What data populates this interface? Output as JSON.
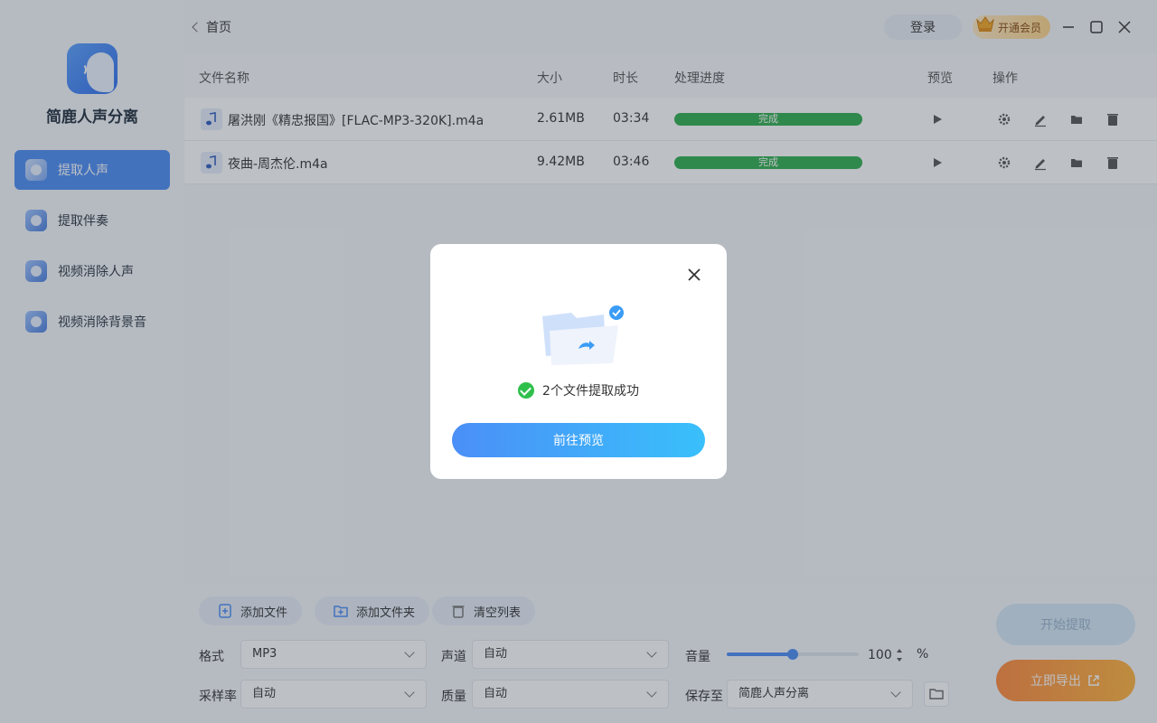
{
  "app": {
    "name": "简鹿人声分离"
  },
  "sidebar": {
    "items": [
      {
        "label": "提取人声",
        "icon": "vocal-extract-icon",
        "active": true
      },
      {
        "label": "提取伴奏",
        "icon": "accompaniment-icon",
        "active": false
      },
      {
        "label": "视频消除人声",
        "icon": "video-vocal-remove-icon",
        "active": false
      },
      {
        "label": "视频消除背景音",
        "icon": "video-bg-remove-icon",
        "active": false
      }
    ]
  },
  "header": {
    "breadcrumb": "首页",
    "login_label": "登录",
    "vip_label": "开通会员"
  },
  "table": {
    "columns": [
      "文件名称",
      "大小",
      "时长",
      "处理进度",
      "预览",
      "操作"
    ],
    "rows": [
      {
        "name": "屠洪刚《精忠报国》[FLAC-MP3-320K].m4a",
        "size": "2.61MB",
        "duration": "03:34",
        "status": "完成",
        "progress": 1.0
      },
      {
        "name": "夜曲-周杰伦.m4a",
        "size": "9.42MB",
        "duration": "03:46",
        "status": "完成",
        "progress": 1.0
      }
    ]
  },
  "toolbar": {
    "add_file": "添加文件",
    "add_folder": "添加文件夹",
    "clear_list": "清空列表"
  },
  "settings": {
    "format": {
      "label": "格式",
      "value": "MP3"
    },
    "channel": {
      "label": "声道",
      "value": "自动"
    },
    "volume": {
      "label": "音量",
      "value": "100",
      "unit": "%",
      "level": 0.5
    },
    "sample_rate": {
      "label": "采样率",
      "value": "自动"
    },
    "quality": {
      "label": "质量",
      "value": "自动"
    },
    "save_to": {
      "label": "保存至",
      "value": "简鹿人声分离"
    }
  },
  "actions": {
    "start_label": "开始提取",
    "export_label": "立即导出"
  },
  "modal": {
    "message": "2个文件提取成功",
    "button_label": "前往预览"
  },
  "colors": {
    "accent": "#4c8cf5",
    "success": "#2fae4e",
    "export": "#ff9a3d"
  }
}
